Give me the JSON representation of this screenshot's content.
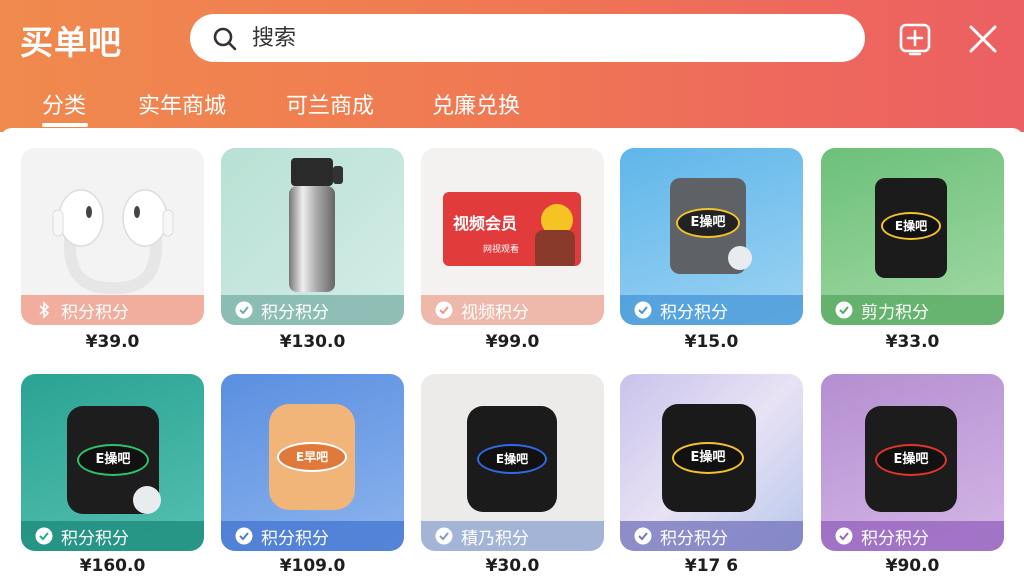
{
  "app": {
    "title": "买单吧",
    "search_placeholder": "搜索"
  },
  "tabs": [
    {
      "label": "分类",
      "active": true
    },
    {
      "label": "实年商城",
      "active": false
    },
    {
      "label": "可兰商成",
      "active": false
    },
    {
      "label": "兑廉兑换",
      "active": false
    }
  ],
  "products": [
    {
      "badge": "积分积分",
      "price": "¥39.0",
      "badge_icon": "bluetooth-icon",
      "image": "earbuds"
    },
    {
      "badge": "积分积分",
      "price": "¥130.0",
      "badge_icon": "check-icon",
      "image": "thermos"
    },
    {
      "badge": "视频积分",
      "price": "¥99.0",
      "badge_icon": "check-icon",
      "image": "video-card",
      "card_title": "视频会员",
      "card_sub": "网视观看"
    },
    {
      "badge": "积分积分",
      "price": "¥15.0",
      "badge_icon": "check-icon",
      "image": "speaker",
      "logo": "E操吧"
    },
    {
      "badge": "剪力积分",
      "price": "¥33.0",
      "badge_icon": "check-icon",
      "image": "speaker",
      "logo": "E操吧"
    },
    {
      "badge": "积分积分",
      "price": "¥160.0",
      "badge_icon": "check-icon",
      "image": "bag",
      "logo": "E操吧"
    },
    {
      "badge": "积分积分",
      "price": "¥109.0",
      "badge_icon": "check-icon",
      "image": "bag",
      "logo": "E早吧"
    },
    {
      "badge": "積乃积分",
      "price": "¥30.0",
      "badge_icon": "check-icon",
      "image": "bag",
      "logo": "E操吧"
    },
    {
      "badge": "积分积分",
      "price": "¥17 6",
      "badge_icon": "check-icon",
      "image": "bag",
      "logo": "E操吧"
    },
    {
      "badge": "积分积分",
      "price": "¥90.0",
      "badge_icon": "check-icon",
      "image": "bag",
      "logo": "E操吧"
    }
  ],
  "colors": {
    "header_start": "#f08a4e",
    "header_end": "#ec5f62"
  }
}
